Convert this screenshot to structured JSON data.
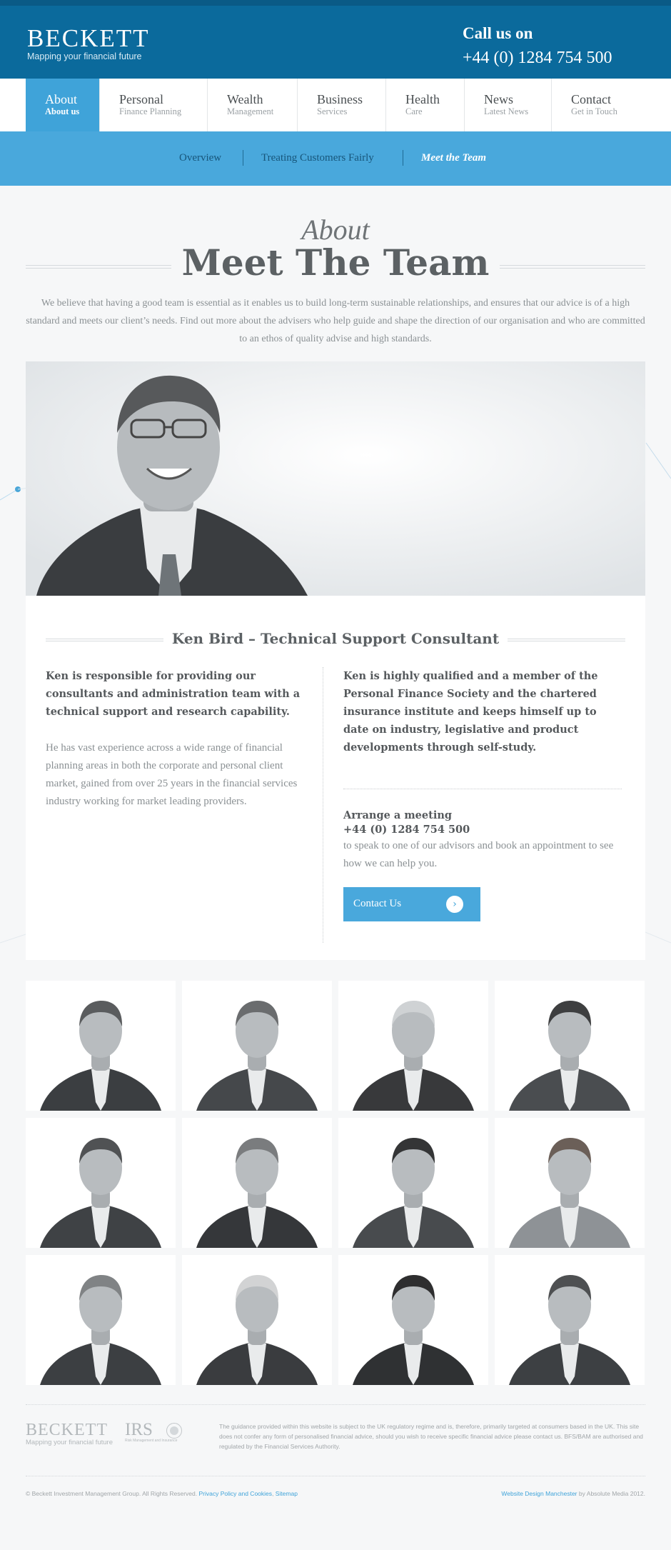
{
  "brand": {
    "name": "BECKETT",
    "tagline": "Mapping your financial future",
    "call_label": "Call us on",
    "phone": "+44 (0) 1284 754 500"
  },
  "nav": [
    {
      "title": "About",
      "sub": "About us",
      "active": true
    },
    {
      "title": "Personal",
      "sub": "Finance Planning"
    },
    {
      "title": "Wealth",
      "sub": "Management"
    },
    {
      "title": "Business",
      "sub": "Services"
    },
    {
      "title": "Health",
      "sub": "Care"
    },
    {
      "title": "News",
      "sub": "Latest News"
    },
    {
      "title": "Contact",
      "sub": "Get in Touch"
    }
  ],
  "subnav": [
    "Overview",
    "Treating Customers Fairly",
    "Meet the Team"
  ],
  "page": {
    "kicker": "About",
    "title": "Meet The Team",
    "intro": "We believe that having a good team is essential as it enables us to build long-term sustainable relationships, and ensures that our advice is of a high standard and meets our client’s needs. Find out more about the advisers who help guide and shape the direction of our organisation and who are committed to an ethos of quality advise and high standards."
  },
  "profile": {
    "heading": "Ken Bird – Technical Support Consultant",
    "left_lead": "Ken is responsible for providing our consultants and administration team with a technical support and research capability.",
    "left_body": "He has vast experience across a wide range of financial planning areas in both the corporate and personal client market, gained from over 25 years in the financial services industry working for market leading providers.",
    "right_lead": "Ken is highly qualified and a member of the Personal Finance Society and the chartered insurance institute and keeps himself up to date on industry, legislative and product developments through self-study.",
    "meeting_title": "Arrange a meeting",
    "meeting_phone": "+44 (0) 1284 754 500",
    "meeting_text": "to speak to one of our advisors and book an appointment to see how we can help you.",
    "contact_button": "Contact Us"
  },
  "footer": {
    "logo_name": "BECKETT",
    "logo_tagline": "Mapping your financial future",
    "partner": "IRS",
    "partner_tagline": "Risk Management and Insurance",
    "disclaimer": "The guidance provided within this website is subject to the UK regulatory regime and is, therefore, primarily targeted at consumers based in the UK. This site does not confer any form of personalised financial advice, should you wish to receive specific financial advice please contact us. BFS/BAM are authorised and regulated by the Financial Services Authority.",
    "copyright": "© Beckett Investment Management Group. All Rights Reserved.",
    "privacy_link": "Privacy Policy and Cookies",
    "sitemap_link": "Sitemap",
    "credit_link": "Website Design Manchester",
    "credit_text": "by Absolute Media 2012."
  },
  "colors": {
    "header": "#0b6a9c",
    "accent": "#49a8dc",
    "nav_active": "#3fa3d9"
  }
}
